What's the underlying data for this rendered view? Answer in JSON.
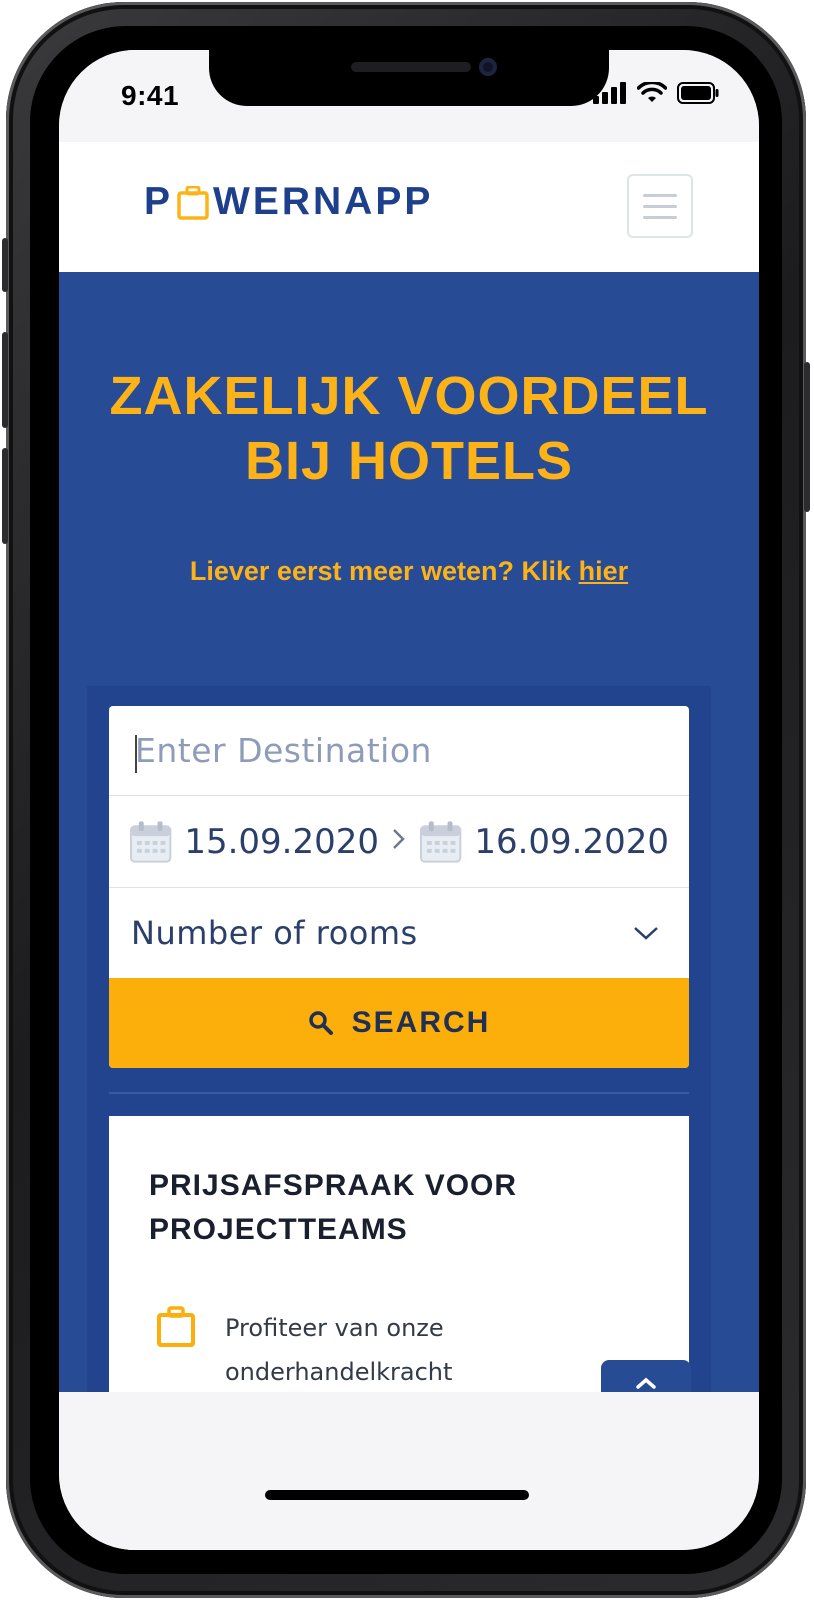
{
  "status_bar": {
    "time": "9:41"
  },
  "header": {
    "logo_pre": "P",
    "logo_post": "WERNAPP"
  },
  "hero": {
    "title": "ZAKELIJK VOORDEEL BIJ HOTELS",
    "subtitle": "Liever eerst meer weten? Klik",
    "subtitle_link": "hier"
  },
  "search": {
    "destination_placeholder": "Enter Destination",
    "checkin": "15.09.2020",
    "checkout": "16.09.2020",
    "rooms_label": "Number of rooms",
    "button_label": "SEARCH"
  },
  "card": {
    "title": "PRIJSAFSPRAAK VOOR PROJECTTEAMS",
    "benefit": "Profiteer van onze onderhandelkracht"
  },
  "colors": {
    "brand_blue": "#274b95",
    "accent_yellow": "#fcae0a",
    "logo_blue": "#1d3f8c"
  }
}
